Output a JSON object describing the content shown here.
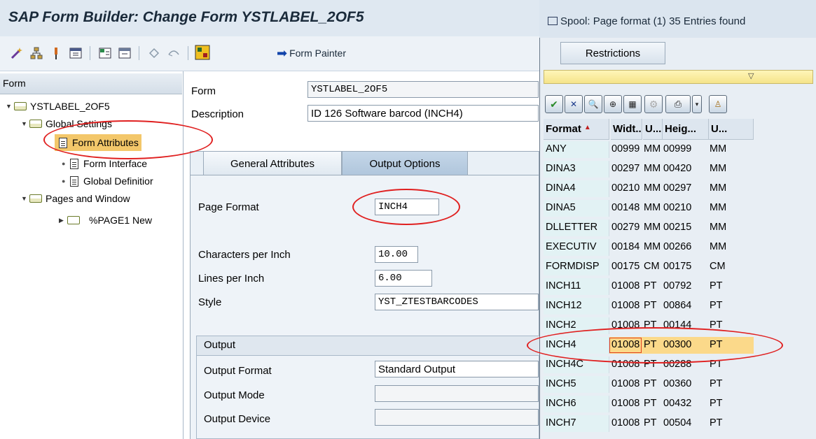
{
  "window": {
    "title": "SAP Form Builder: Change Form YSTLABEL_2OF5"
  },
  "toolbar": {
    "icons": [
      "magic-wand-icon",
      "hierarchy-icon",
      "pin-icon",
      "layout-icon",
      "expand-icon",
      "collapse-icon",
      "undo-icon",
      "redo-icon",
      "palette-icon"
    ],
    "form_painter_label": "Form Painter"
  },
  "tree": {
    "header": "Form",
    "items": [
      {
        "label": "YSTLABEL_2OF5"
      },
      {
        "label": "Global Settings"
      },
      {
        "label": "Form Attributes"
      },
      {
        "label": "Form Interface"
      },
      {
        "label": "Global Definitior"
      },
      {
        "label": "Pages and Window"
      },
      {
        "label": "%PAGE1 New"
      }
    ]
  },
  "form_header": {
    "form_label": "Form",
    "form_value": "YSTLABEL_2OF5",
    "description_label": "Description",
    "description_value": "ID 126 Software barcod (INCH4)"
  },
  "tabs": [
    {
      "label": "General Attributes"
    },
    {
      "label": "Output Options"
    }
  ],
  "output_options": {
    "page_format_label": "Page Format",
    "page_format_value": "INCH4",
    "cpi_label": "Characters per Inch",
    "cpi_value": "10.00",
    "lpi_label": "Lines per Inch",
    "lpi_value": "6.00",
    "style_label": "Style",
    "style_value": "YST_ZTESTBARCODES"
  },
  "output_group": {
    "title": "Output",
    "output_format_label": "Output Format",
    "output_format_value": "Standard Output",
    "output_mode_label": "Output Mode",
    "output_device_label": "Output Device"
  },
  "popup": {
    "title": "Spool: Page format (1)   35 Entries found",
    "restrictions_tab": "Restrictions",
    "columns": [
      "Format",
      "Widt...",
      "U...",
      "Heig...",
      "U..."
    ],
    "rows": [
      {
        "format": "ANY",
        "width": "00999",
        "wunit": "MM",
        "height": "00999",
        "hunit": "MM"
      },
      {
        "format": "DINA3",
        "width": "00297",
        "wunit": "MM",
        "height": "00420",
        "hunit": "MM"
      },
      {
        "format": "DINA4",
        "width": "00210",
        "wunit": "MM",
        "height": "00297",
        "hunit": "MM"
      },
      {
        "format": "DINA5",
        "width": "00148",
        "wunit": "MM",
        "height": "00210",
        "hunit": "MM"
      },
      {
        "format": "DLLETTER",
        "width": "00279",
        "wunit": "MM",
        "height": "00215",
        "hunit": "MM"
      },
      {
        "format": "EXECUTIV",
        "width": "00184",
        "wunit": "MM",
        "height": "00266",
        "hunit": "MM"
      },
      {
        "format": "FORMDISP",
        "width": "00175",
        "wunit": "CM",
        "height": "00175",
        "hunit": "CM"
      },
      {
        "format": "INCH11",
        "width": "01008",
        "wunit": "PT",
        "height": "00792",
        "hunit": "PT"
      },
      {
        "format": "INCH12",
        "width": "01008",
        "wunit": "PT",
        "height": "00864",
        "hunit": "PT"
      },
      {
        "format": "INCH2",
        "width": "01008",
        "wunit": "PT",
        "height": "00144",
        "hunit": "PT"
      },
      {
        "format": "INCH4",
        "width": "01008",
        "wunit": "PT",
        "height": "00300",
        "hunit": "PT"
      },
      {
        "format": "INCH4C",
        "width": "01008",
        "wunit": "PT",
        "height": "00288",
        "hunit": "PT"
      },
      {
        "format": "INCH5",
        "width": "01008",
        "wunit": "PT",
        "height": "00360",
        "hunit": "PT"
      },
      {
        "format": "INCH6",
        "width": "01008",
        "wunit": "PT",
        "height": "00432",
        "hunit": "PT"
      },
      {
        "format": "INCH7",
        "width": "01008",
        "wunit": "PT",
        "height": "00504",
        "hunit": "PT"
      }
    ],
    "selected_row": "INCH4"
  },
  "colors": {
    "annotation": "#e02020",
    "selection": "#fbd98a",
    "format_column": "#e2f2f4"
  }
}
